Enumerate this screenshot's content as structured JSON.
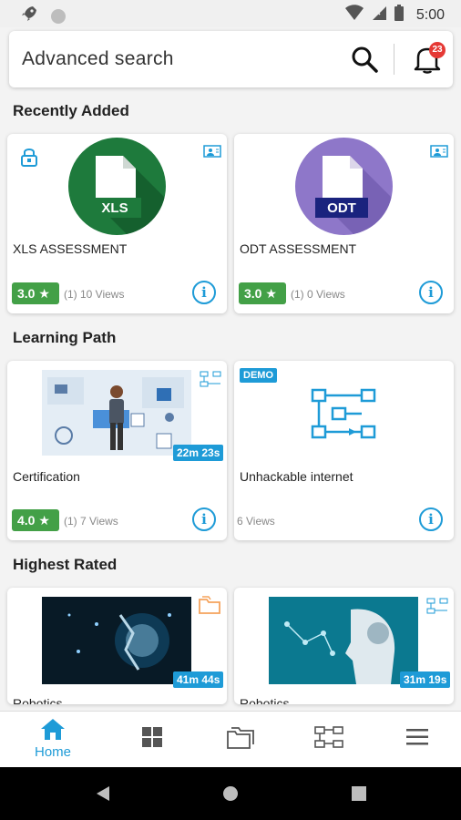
{
  "status_bar": {
    "time": "5:00",
    "icons": [
      "rocket-icon",
      "circle-icon",
      "wifi-icon",
      "signal-icon",
      "battery-icon"
    ]
  },
  "search": {
    "placeholder": "Advanced search",
    "notification_count": "23"
  },
  "sections": [
    {
      "title": "Recently Added",
      "cards": [
        {
          "title": "XLS ASSESSMENT",
          "file_label": "XLS",
          "rating": "3.0 ★",
          "views": "(1) 10 Views"
        },
        {
          "title": "ODT ASSESSMENT",
          "file_label": "ODT",
          "rating": "3.0 ★",
          "views": "(1) 0 Views"
        }
      ]
    },
    {
      "title": "Learning Path",
      "cards": [
        {
          "title": "Certification",
          "duration": "22m 23s",
          "rating": "4.0 ★",
          "views": "(1) 7 Views"
        },
        {
          "title": "Unhackable internet",
          "tag": "DEMO",
          "views": "6 Views"
        }
      ]
    },
    {
      "title": "Highest Rated",
      "cards": [
        {
          "title": "Robotics",
          "duration": "41m 44s"
        },
        {
          "title": "Robotics",
          "duration": "31m 19s"
        }
      ]
    }
  ],
  "bottom_nav": {
    "home_label": "Home",
    "items": [
      "home-icon",
      "grid-icon",
      "folders-icon",
      "learning-path-icon",
      "menu-icon"
    ]
  },
  "colors": {
    "accent": "#1e9bd7",
    "rating_green": "#43a047",
    "xls_green": "#1e7a3c",
    "odt_purple": "#8e77c9",
    "badge_red": "#e53935"
  }
}
